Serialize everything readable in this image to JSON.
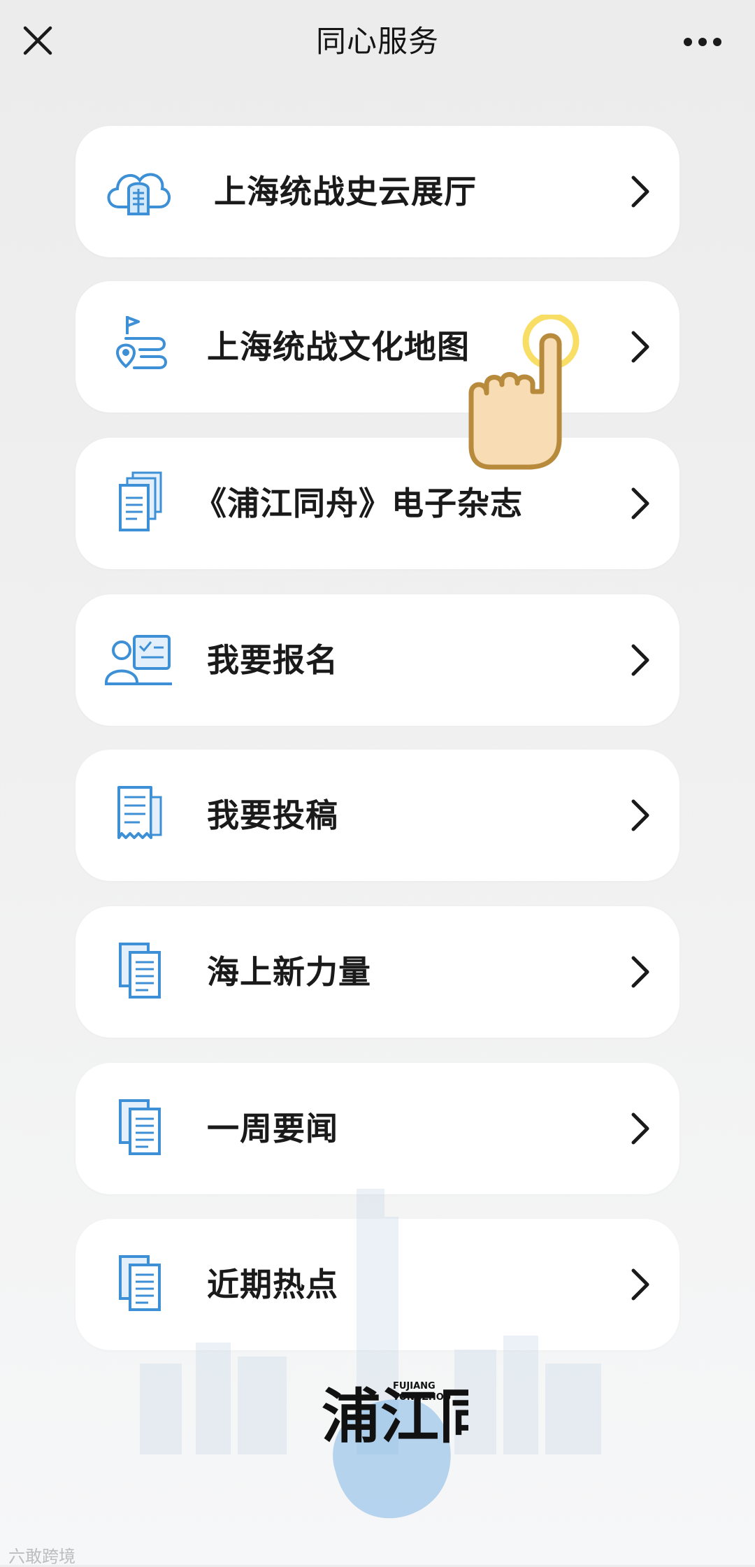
{
  "header": {
    "title": "同心服务"
  },
  "menu": [
    {
      "label": "上海统战史云展厅",
      "icon": "cloud-hall-icon"
    },
    {
      "label": "上海统战文化地图",
      "icon": "map-pin-route-icon"
    },
    {
      "label": "《浦江同舟》电子杂志",
      "icon": "magazine-stack-icon"
    },
    {
      "label": "我要报名",
      "icon": "person-signup-icon"
    },
    {
      "label": "我要投稿",
      "icon": "document-submit-icon"
    },
    {
      "label": "海上新力量",
      "icon": "document-copy-icon"
    },
    {
      "label": "一周要闻",
      "icon": "document-copy-icon"
    },
    {
      "label": "近期热点",
      "icon": "document-copy-icon"
    }
  ],
  "footer": {
    "brand_cn": "浦江同舟",
    "brand_en_line1": "FUJIANG",
    "brand_en_line2": "TONGZHOU",
    "watermark": "六敢跨境"
  },
  "colors": {
    "icon_blue": "#3d8fd6",
    "accent_yellow": "#f7d84a",
    "hand_fill": "#f8ddb4",
    "hand_stroke": "#b78a3c"
  }
}
